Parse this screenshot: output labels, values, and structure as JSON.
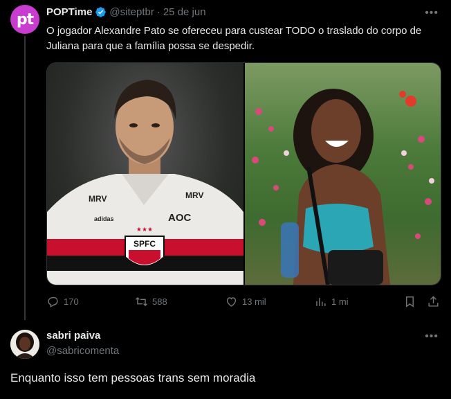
{
  "tweet": {
    "avatar_text": "pt",
    "display_name": "POPTime",
    "handle": "@siteptbr",
    "separator": "·",
    "date": "25 de jun",
    "text": "O jogador Alexandre Pato se ofereceu para custear TODO o traslado do corpo de Juliana para que a família possa se despedir.",
    "more": "•••",
    "media": {
      "left_jersey_brand": "MRV",
      "left_jersey_sponsor": "AOC",
      "left_jersey_crest": "SPFC",
      "left_jersey_maker": "adidas"
    },
    "actions": {
      "replies": "170",
      "reposts": "588",
      "likes": "13 mil",
      "views": "1 mi"
    },
    "colors": {
      "verified": "#1d9bf0",
      "avatar_bg": "#c83ccf"
    }
  },
  "reply": {
    "display_name": "sabri paiva",
    "handle": "@sabricomenta",
    "more": "•••",
    "text": "Enquanto isso tem pessoas trans sem moradia"
  }
}
